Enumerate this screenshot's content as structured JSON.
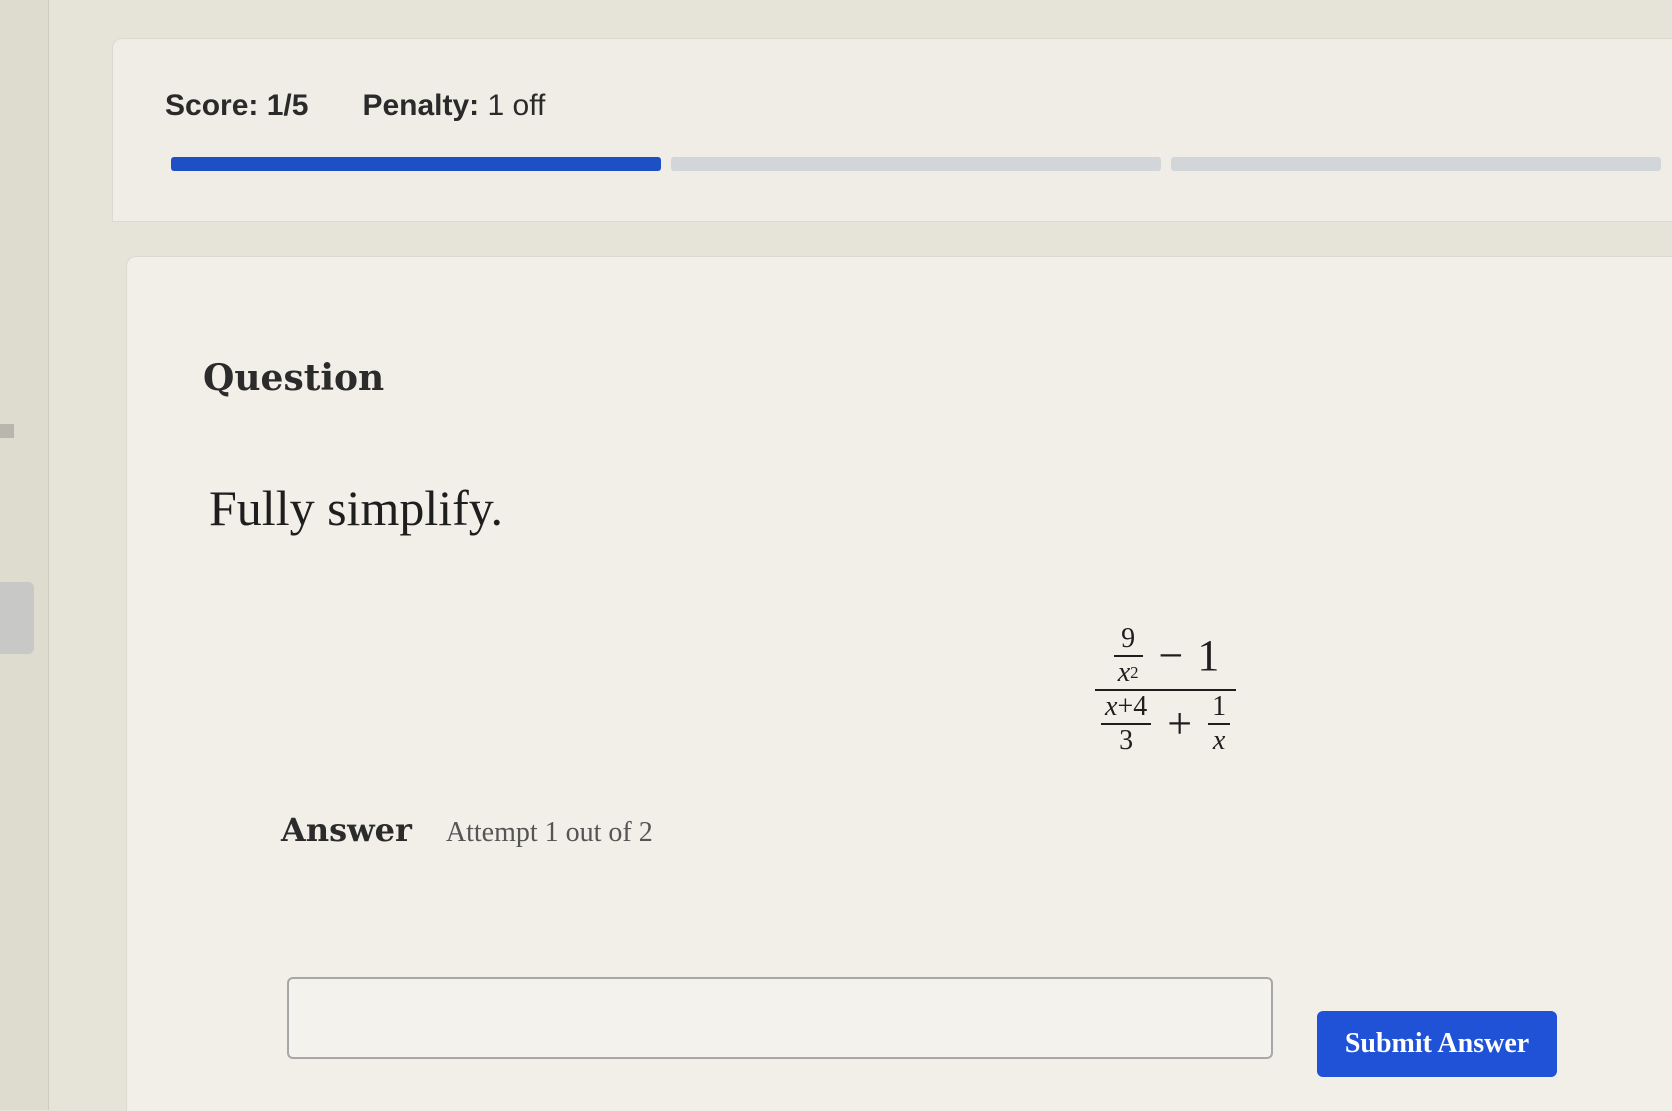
{
  "score": {
    "score_label": "Score:",
    "score_value": "1/5",
    "penalty_label": "Penalty:",
    "penalty_value": "1 off",
    "progress_segments": [
      {
        "complete": true
      },
      {
        "complete": false
      },
      {
        "complete": false
      }
    ]
  },
  "question": {
    "heading": "Question",
    "instruction": "Fully simplify.",
    "expression": {
      "numerator": {
        "small_fraction": {
          "numerator": "9",
          "denominator_var": "x",
          "denominator_exp": "2"
        },
        "operator": "−",
        "constant": "1"
      },
      "denominator": {
        "left_fraction": {
          "numerator_var": "x",
          "numerator_op": "+",
          "numerator_const": "4",
          "denominator": "3"
        },
        "operator": "+",
        "right_fraction": {
          "numerator": "1",
          "denominator_var": "x"
        }
      }
    }
  },
  "answer": {
    "label": "Answer",
    "attempt_text": "Attempt 1 out of 2",
    "input_value": "",
    "submit_label": "Submit Answer"
  },
  "colors": {
    "progress_complete": "#1f4fc4",
    "progress_incomplete": "#d3d6d8",
    "submit_button": "#1f52d6"
  }
}
